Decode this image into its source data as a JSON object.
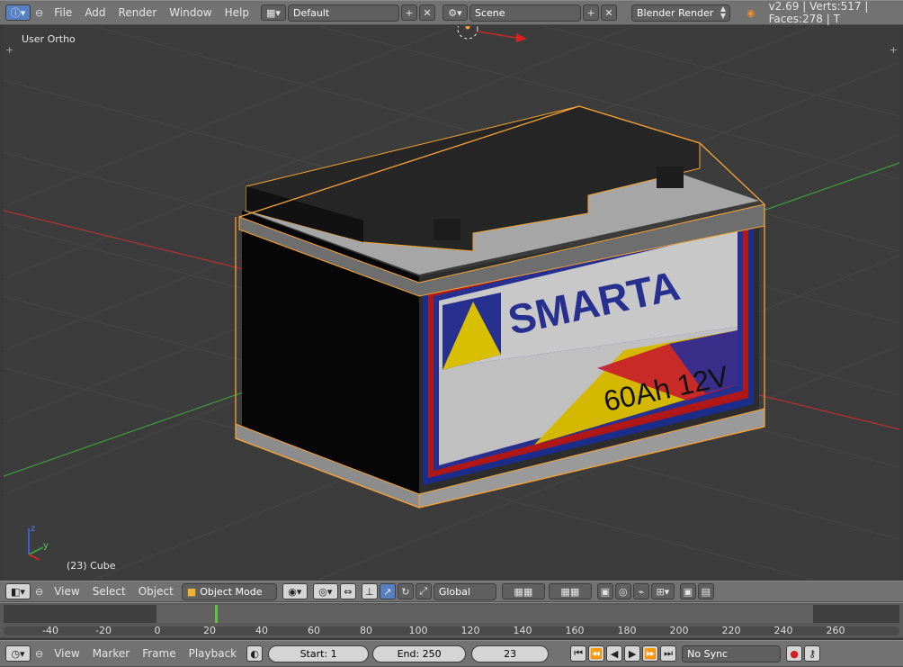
{
  "top_bar": {
    "menus": [
      "File",
      "Add",
      "Render",
      "Window",
      "Help"
    ],
    "screen_layout": "Default",
    "scene": "Scene",
    "render_engine": "Blender Render",
    "info": "v2.69 | Verts:517 | Faces:278 | T"
  },
  "viewport": {
    "view_name": "User Ortho",
    "object_info": "(23) Cube",
    "axis_labels": {
      "z": "z",
      "y": "y"
    },
    "battery_label": {
      "brand": "SMARTA",
      "rating": "60Ah 12V"
    }
  },
  "view_header": {
    "menus": [
      "View",
      "Select",
      "Object"
    ],
    "mode": "Object Mode",
    "orientation": "Global"
  },
  "timeline": {
    "ticks": [
      "-40",
      "-20",
      "0",
      "20",
      "40",
      "60",
      "80",
      "100",
      "120",
      "140",
      "160",
      "180",
      "200",
      "220",
      "240",
      "260"
    ],
    "current_frame_marker": 23
  },
  "timeline_header": {
    "menus": [
      "View",
      "Marker",
      "Frame",
      "Playback"
    ],
    "start": "Start: 1",
    "end": "End: 250",
    "current_frame": "23",
    "sync": "No Sync"
  },
  "colors": {
    "selection_outline": "#f7a233",
    "x_axis": "#b43232",
    "y_axis": "#3c9c3c",
    "active_button": "#5680c2"
  }
}
